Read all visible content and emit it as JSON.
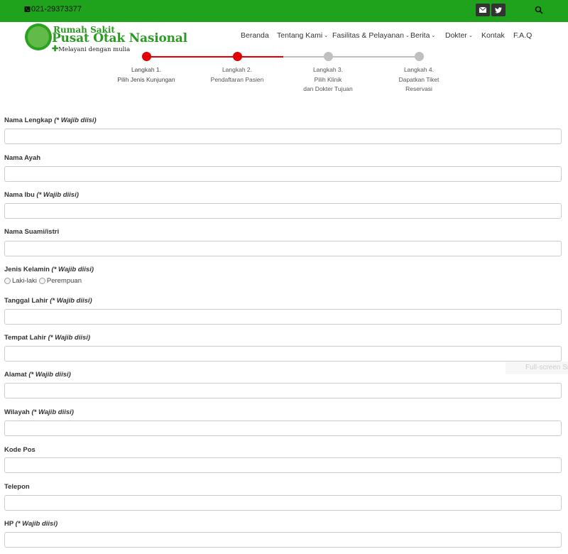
{
  "topbar": {
    "phone": "021-29373377",
    "bg_color": "#1fa31c",
    "phone_icon": "phone-icon",
    "mail_icon": "envelope-icon",
    "twitter_icon": "twitter-icon",
    "search_icon": "search-icon"
  },
  "logo": {
    "line1": "Rumah Sakit",
    "line2": "Pusat Otak Nasional",
    "tagline_plus": "✚",
    "tagline": "Melayani dengan mulia"
  },
  "nav": [
    {
      "label": "Beranda",
      "caret": ""
    },
    {
      "label": "Tentang Kami",
      "caret": "⌄"
    },
    {
      "label": "Fasilitas & Pelayanan",
      "caret": "⌄"
    },
    {
      "label": "Berita",
      "caret": "⌄"
    },
    {
      "label": "Dokter",
      "caret": "⌄"
    },
    {
      "label": "Kontak",
      "caret": ""
    },
    {
      "label": "F.A.Q",
      "caret": ""
    }
  ],
  "steps": [
    {
      "title": "Langkah 1.",
      "desc": "Pilih Jenis Kunjungan",
      "desc2": ""
    },
    {
      "title": "Langkah 2.",
      "desc": "Pendaftaran Pasien",
      "desc2": ""
    },
    {
      "title": "Langkah 3.",
      "desc": "Pilih Klinik",
      "desc2": "dan Dokter Tujuan"
    },
    {
      "title": "Langkah 4.",
      "desc": "Dapatkan Tiket",
      "desc2": "Reservasi"
    }
  ],
  "steps_completed": 2,
  "colors": {
    "active": "#e00000",
    "inactive": "#c0c0c0"
  },
  "form": {
    "required_note": "(* Wajib diisi)",
    "fields": {
      "nama_lengkap": {
        "label": "Nama Lengkap",
        "value": ""
      },
      "nama_ayah": {
        "label": "Nama Ayah",
        "value": ""
      },
      "nama_ibu": {
        "label": "Nama Ibu",
        "value": ""
      },
      "nama_suami": {
        "label": "Nama Suami/istri",
        "value": ""
      },
      "jenis_kelamin": {
        "label": "Jenis Kelamin",
        "options": [
          "Laki-laki",
          "Perempuan"
        ]
      },
      "tanggal_lahir": {
        "label": "Tanggal Lahir",
        "value": ""
      },
      "tempat_lahir": {
        "label": "Tempat Lahir",
        "value": ""
      },
      "alamat": {
        "label": "Alamat",
        "value": ""
      },
      "wilayah": {
        "label": "Wilayah",
        "value": ""
      },
      "kode_pos": {
        "label": "Kode Pos",
        "value": ""
      },
      "telepon": {
        "label": "Telepon",
        "value": ""
      },
      "hp": {
        "label": "HP",
        "value": ""
      }
    }
  },
  "overlay": {
    "fullscreen_text": "Full-screen Sn"
  }
}
